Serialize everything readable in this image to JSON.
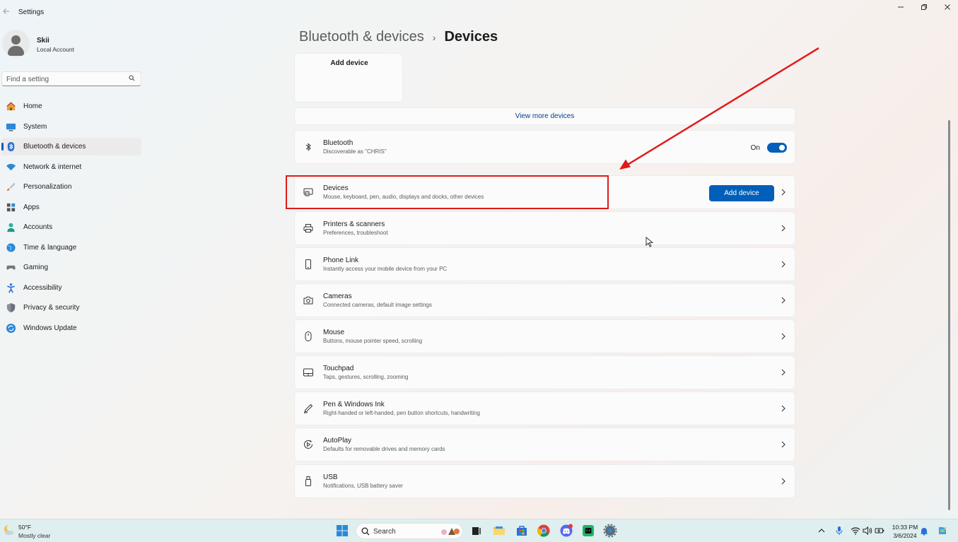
{
  "window": {
    "title": "Settings",
    "back_icon": "back-arrow-icon",
    "controls": [
      "minimize-icon",
      "restore-icon",
      "close-icon"
    ]
  },
  "profile": {
    "name": "Skii",
    "account_type": "Local Account"
  },
  "search": {
    "placeholder": "Find a setting"
  },
  "sidebar": {
    "items": [
      {
        "label": "Home",
        "icon": "home-icon",
        "active": false
      },
      {
        "label": "System",
        "icon": "system-icon",
        "active": false
      },
      {
        "label": "Bluetooth & devices",
        "icon": "bluetooth-icon",
        "active": true
      },
      {
        "label": "Network & internet",
        "icon": "wifi-icon",
        "active": false
      },
      {
        "label": "Personalization",
        "icon": "brush-icon",
        "active": false
      },
      {
        "label": "Apps",
        "icon": "apps-icon",
        "active": false
      },
      {
        "label": "Accounts",
        "icon": "person-icon",
        "active": false
      },
      {
        "label": "Time & language",
        "icon": "globe-icon",
        "active": false
      },
      {
        "label": "Gaming",
        "icon": "controller-icon",
        "active": false
      },
      {
        "label": "Accessibility",
        "icon": "accessibility-icon",
        "active": false
      },
      {
        "label": "Privacy & security",
        "icon": "shield-icon",
        "active": false
      },
      {
        "label": "Windows Update",
        "icon": "update-icon",
        "active": false
      }
    ]
  },
  "header": {
    "parent": "Bluetooth & devices",
    "separator": "›",
    "current": "Devices"
  },
  "add_tile": {
    "label": "Add device"
  },
  "view_more": {
    "label": "View more devices"
  },
  "bluetooth": {
    "title": "Bluetooth",
    "subtitle": "Discoverable as \"CHRIS\"",
    "state": "On",
    "enabled": true
  },
  "devices_row": {
    "title": "Devices",
    "subtitle": "Mouse, keyboard, pen, audio, displays and docks, other devices",
    "button": "Add device"
  },
  "rows": [
    {
      "title": "Printers & scanners",
      "subtitle": "Preferences, troubleshoot",
      "icon": "printer-icon"
    },
    {
      "title": "Phone Link",
      "subtitle": "Instantly access your mobile device from your PC",
      "icon": "phone-icon"
    },
    {
      "title": "Cameras",
      "subtitle": "Connected cameras, default image settings",
      "icon": "camera-icon"
    },
    {
      "title": "Mouse",
      "subtitle": "Buttons, mouse pointer speed, scrolling",
      "icon": "mouse-icon"
    },
    {
      "title": "Touchpad",
      "subtitle": "Taps, gestures, scrolling, zooming",
      "icon": "touchpad-icon"
    },
    {
      "title": "Pen & Windows Ink",
      "subtitle": "Right-handed or left-handed, pen button shortcuts, handwriting",
      "icon": "pen-icon"
    },
    {
      "title": "AutoPlay",
      "subtitle": "Defaults for removable drives and memory cards",
      "icon": "autoplay-icon"
    },
    {
      "title": "USB",
      "subtitle": "Notifications, USB battery saver",
      "icon": "usb-icon"
    }
  ],
  "annotation": {
    "color": "#e01a1a"
  },
  "colors": {
    "accent": "#005fb8"
  },
  "taskbar": {
    "weather": {
      "temp": "50°F",
      "condition": "Mostly clear"
    },
    "search_label": "Search",
    "time": "10:33 PM",
    "date": "3/6/2024",
    "apps": [
      "start-icon",
      "search-icon",
      "task-view-icon",
      "file-explorer-icon",
      "store-icon",
      "chrome-icon",
      "discord-icon",
      "app-icon",
      "settings-icon"
    ],
    "tray": [
      "chevron-up-icon",
      "microphone-icon",
      "wifi-icon",
      "volume-icon",
      "battery-icon",
      "notification-icon",
      "copilot-icon"
    ]
  }
}
